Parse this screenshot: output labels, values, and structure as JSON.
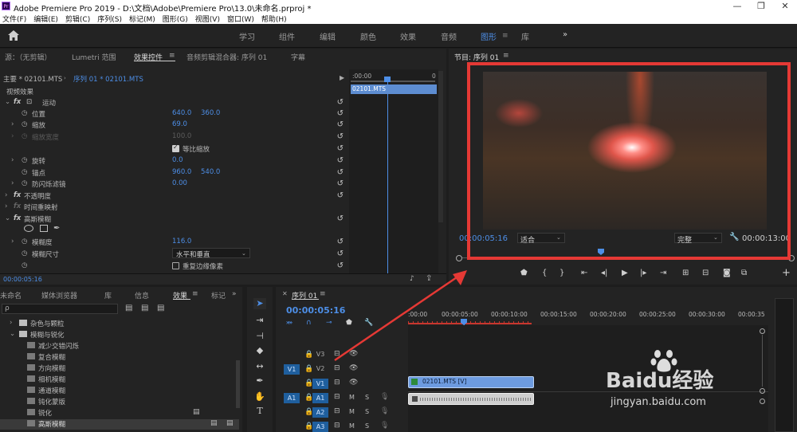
{
  "window": {
    "title": "Adobe Premiere Pro 2019 - D:\\文档\\Adobe\\Premiere Pro\\13.0\\未命名.prproj *",
    "app_icon": "Pr",
    "minimize": "—",
    "restore": "❐",
    "close": "✕"
  },
  "menu": [
    "文件(F)",
    "编辑(E)",
    "剪辑(C)",
    "序列(S)",
    "标记(M)",
    "图形(G)",
    "视图(V)",
    "窗口(W)",
    "帮助(H)"
  ],
  "workspaces": {
    "items": [
      "学习",
      "组件",
      "编辑",
      "颜色",
      "效果",
      "音频",
      "图形",
      "库"
    ],
    "active": "图形",
    "more": "»"
  },
  "source_panel": {
    "tabs": [
      "源：（无剪辑）",
      "Lumetri 范围",
      "效果控件",
      "音频剪辑混合器: 序列 01",
      "字幕"
    ],
    "active_tab": "效果控件",
    "master_label": "主要 * 02101.MTS",
    "sequence_label": "序列 01 * 02101.MTS",
    "mini_timecode": ":00:00",
    "mini_end": "0",
    "mini_clip": "02101.MTS",
    "video_effects_label": "视频效果",
    "effects": [
      {
        "kind": "group",
        "name": "运动",
        "expanded": true
      },
      {
        "kind": "prop",
        "name": "位置",
        "v1": "640.0",
        "v2": "360.0"
      },
      {
        "kind": "prop",
        "name": "缩放",
        "v1": "69.0"
      },
      {
        "kind": "prop-disabled",
        "name": "缩放宽度",
        "v1": "100.0"
      },
      {
        "kind": "check",
        "name": "等比缩放",
        "checked": true
      },
      {
        "kind": "prop",
        "name": "旋转",
        "v1": "0.0"
      },
      {
        "kind": "prop",
        "name": "锚点",
        "v1": "960.0",
        "v2": "540.0"
      },
      {
        "kind": "prop",
        "name": "防闪烁滤镜",
        "v1": "0.00"
      },
      {
        "kind": "group",
        "name": "不透明度"
      },
      {
        "kind": "group",
        "name": "时间重映射"
      },
      {
        "kind": "group",
        "name": "高斯模糊",
        "expanded": true
      },
      {
        "kind": "masks"
      },
      {
        "kind": "prop",
        "name": "模糊度",
        "v1": "116.0"
      },
      {
        "kind": "select",
        "name": "模糊尺寸",
        "value": "水平和垂直"
      },
      {
        "kind": "check",
        "name": "重复边缘像素",
        "checked": false
      }
    ],
    "timecode": "00:00:05:16"
  },
  "program_monitor": {
    "title": "节目: 序列 01",
    "timecode": "00:00:05:16",
    "fit": "适合",
    "quality": "完整",
    "duration": "00:00:13:00"
  },
  "project_panel": {
    "tabs": [
      "未命名",
      "媒体浏览器",
      "库",
      "信息",
      "效果",
      "标记"
    ],
    "active_tab": "效果",
    "search_placeholder": "ρ",
    "folders": [
      {
        "name": "杂色与颗粒",
        "indent": 1,
        "expanded": false,
        "folder": true
      },
      {
        "name": "模糊与锐化",
        "indent": 1,
        "expanded": true,
        "folder": true
      },
      {
        "name": "减少交错闪烁",
        "indent": 2
      },
      {
        "name": "复合模糊",
        "indent": 2
      },
      {
        "name": "方向模糊",
        "indent": 2
      },
      {
        "name": "相机模糊",
        "indent": 2
      },
      {
        "name": "通道模糊",
        "indent": 2
      },
      {
        "name": "钝化蒙版",
        "indent": 2
      },
      {
        "name": "锐化",
        "indent": 2,
        "badge": true
      },
      {
        "name": "高斯模糊",
        "indent": 2,
        "badge": true,
        "selected": true
      }
    ]
  },
  "timeline": {
    "tab": "序列 01",
    "timecode": "00:00:05:16",
    "ruler": [
      ":00:00",
      "00:00:05:00",
      "00:00:10:00",
      "00:00:15:00",
      "00:00:20:00",
      "00:00:25:00",
      "00:00:30:00",
      "00:00:35"
    ],
    "tracks": [
      {
        "src": "",
        "name": "V3",
        "type": "video"
      },
      {
        "src": "V1",
        "name": "V2",
        "type": "video"
      },
      {
        "src": "",
        "name": "V1",
        "type": "video",
        "target": true
      },
      {
        "src": "A1",
        "name": "A1",
        "type": "audio",
        "target": true
      },
      {
        "src": "",
        "name": "A2",
        "type": "audio",
        "target": true
      },
      {
        "src": "",
        "name": "A3",
        "type": "audio",
        "target": true
      }
    ],
    "clip_video": "02101.MTS [V]",
    "mute": "M",
    "solo": "S"
  },
  "watermark": {
    "brand": "Baidu经验",
    "url": "jingyan.baidu.com"
  },
  "colors": {
    "accent_blue": "#4d8ee6",
    "annotation_red": "#e53935",
    "panel_bg": "#232323"
  }
}
